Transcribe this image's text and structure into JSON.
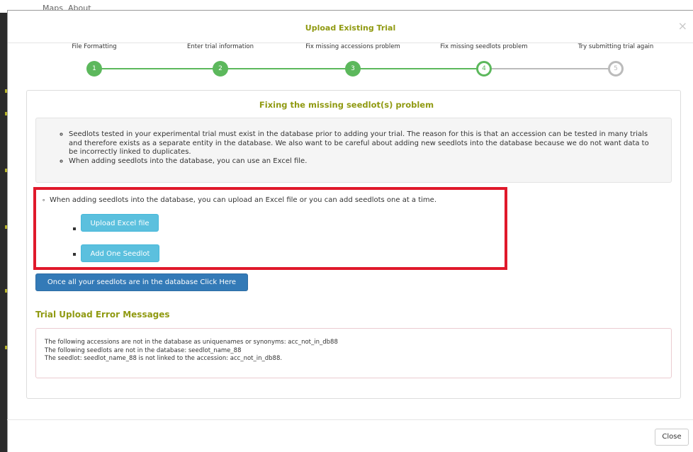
{
  "background_nav": {
    "items": [
      "Maps",
      "About"
    ]
  },
  "modal": {
    "title": "Upload Existing Trial",
    "close_glyph": "×"
  },
  "steps": [
    {
      "label": "File Formatting",
      "number": "1",
      "state": "done"
    },
    {
      "label": "Enter trial information",
      "number": "2",
      "state": "done"
    },
    {
      "label": "Fix missing accessions problem",
      "number": "3",
      "state": "done"
    },
    {
      "label": "Fix missing seedlots problem",
      "number": "4",
      "state": "current"
    },
    {
      "label": "Try submitting trial again",
      "number": "5",
      "state": "todo"
    }
  ],
  "panel": {
    "heading": "Fixing the missing seedlot(s) problem",
    "info": [
      "Seedlots tested in your experimental trial must exist in the database prior to adding your trial. The reason for this is that an accession can be tested in many trials and therefore exists as a separate entity in the database. We also want to be careful about adding new seedlots into the database because we do not want data to be incorrectly linked to duplicates.",
      "When adding seedlots into the database, you can use an Excel file."
    ],
    "add_text": "When adding seedlots into the database, you can upload an Excel file or you can add seedlots one at a time.",
    "upload_button": "Upload Excel file",
    "add_one_button": "Add One Seedlot",
    "proceed_button": "Once all your seedlots are in the database Click Here"
  },
  "errors": {
    "title": "Trial Upload Error Messages",
    "messages": [
      "The following accessions are not in the database as uniquenames or synonyms: acc_not_in_db88",
      "The following seedlots are not in the database: seedlot_name_88",
      "The seedlot: seedlot_name_88 is not linked to the accession: acc_not_in_db88."
    ]
  },
  "footer": {
    "close_label": "Close"
  },
  "colors": {
    "accent": "#909a12",
    "step_done": "#5cb85c",
    "step_todo": "#bbbbbb",
    "highlight": "#e0192b",
    "btn_info": "#5bc0de",
    "btn_primary": "#337ab7"
  }
}
